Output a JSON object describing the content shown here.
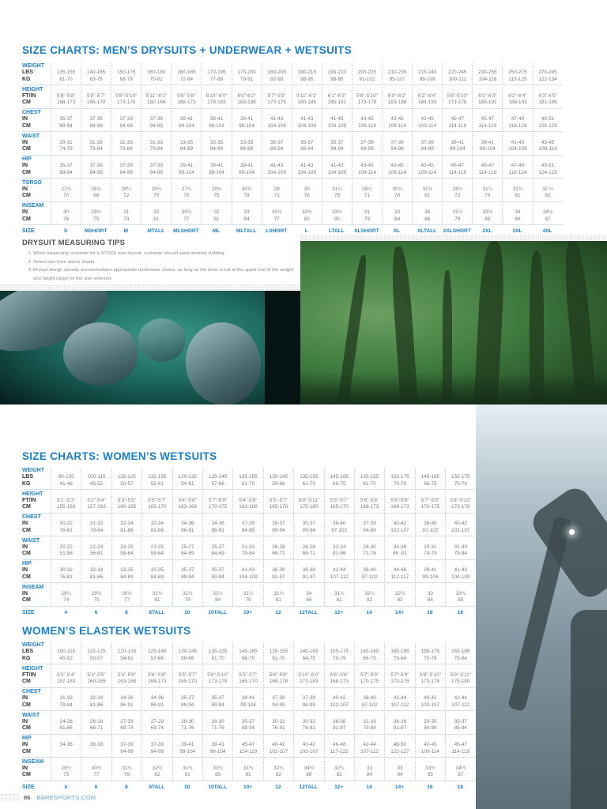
{
  "men": {
    "title": "SIZE CHARTS: MEN’S DRYSUITS + UNDERWEAR + WETSUITS",
    "groups": [
      {
        "group": "WEIGHT",
        "units": [
          "LBS",
          "KG"
        ],
        "rows": [
          [
            "135-155",
            "140-165",
            "150-175",
            "160-180",
            "160-185",
            "170-195",
            "175-200",
            "180-205",
            "190-215",
            "195-210",
            "200-225",
            "210-235",
            "215-240",
            "220-245",
            "230-255",
            "250-275",
            "270-295"
          ],
          [
            "61-70",
            "63-75",
            "68-79",
            "70-82",
            "72-84",
            "77-88",
            "79-91",
            "82-93",
            "88-95",
            "88-95",
            "91-102",
            "95-107",
            "98-109",
            "100-111",
            "104-116",
            "113-125",
            "122-134"
          ]
        ]
      },
      {
        "group": "HEIGHT",
        "units": [
          "FT/IN",
          "CM"
        ],
        "rows": [
          [
            "5'6\"-5'8\"",
            "5'5\"-5'7\"",
            "5'8\"-5'10\"",
            "5'11\"-6'1\"",
            "5'6\"-5'8\"",
            "5'10\"-6'0\"",
            "6'0\"-6'2\"",
            "5'7\"-5'9\"",
            "5'11\"-6'1\"",
            "6'1\"-6'3\"",
            "5'8\"-5'10\"",
            "6'0\"-6'2\"",
            "6'2\"-6'4\"",
            "5'8\"-5'10\"",
            "6'1\"-6'3\"",
            "6'2\"-6'4\"",
            "6'3\"-6'5\""
          ],
          [
            "168-173",
            "165-170",
            "173-178",
            "180-184",
            "168-173",
            "178-183",
            "183-188",
            "170-175",
            "180-185",
            "185-191",
            "173-178",
            "183-188",
            "188-193",
            "173-178",
            "185-191",
            "188-193",
            "191-196"
          ]
        ]
      },
      {
        "group": "CHEST",
        "units": [
          "IN",
          "CM"
        ],
        "rows": [
          [
            "35-37",
            "37-39",
            "37-39",
            "37-39",
            "39-41",
            "39-41",
            "39-41",
            "41-43",
            "41-43",
            "41-43",
            "43-45",
            "43-45",
            "43-45",
            "45-47",
            "45-47",
            "47-49",
            "49-51"
          ],
          [
            "89-94",
            "94-99",
            "94-99",
            "94-99",
            "99-104",
            "99-104",
            "99-104",
            "104-109",
            "104-109",
            "104-109",
            "109-114",
            "109-114",
            "109-114",
            "114-119",
            "114-119",
            "119-124",
            "124-129"
          ]
        ]
      },
      {
        "group": "WAIST",
        "units": [
          "IN",
          "CM"
        ],
        "rows": [
          [
            "29-31",
            "31-33",
            "31-33",
            "31-33",
            "33-35",
            "33-35",
            "33-35",
            "35-37",
            "35-37",
            "35-37",
            "37-39",
            "37-39",
            "37-39",
            "39-41",
            "39-41",
            "41-43",
            "43-45"
          ],
          [
            "74-79",
            "79-84",
            "79-84",
            "79-84",
            "84-89",
            "84-89",
            "84-89",
            "89-94",
            "89-94",
            "89-94",
            "94-99",
            "94-99",
            "94-99",
            "99-104",
            "99-104",
            "104-109",
            "109-114"
          ]
        ]
      },
      {
        "group": "HIP",
        "units": [
          "IN",
          "CM"
        ],
        "rows": [
          [
            "35-37",
            "37-39",
            "37-39",
            "37-39",
            "39-41",
            "39-41",
            "39-41",
            "41-43",
            "41-43",
            "41-43",
            "43-45",
            "43-45",
            "43-45",
            "45-47",
            "45-47",
            "47-49",
            "49-51"
          ],
          [
            "89-94",
            "94-99",
            "94-99",
            "94-99",
            "99-104",
            "99-104",
            "99-104",
            "104-109",
            "104-109",
            "104-109",
            "109-114",
            "109-114",
            "109-114",
            "114-119",
            "114-119",
            "119-124",
            "124-129"
          ]
        ]
      },
      {
        "group": "TORSO",
        "units": [
          "IN",
          "CM"
        ],
        "rows": [
          [
            "27¾",
            "26¾",
            "28¼",
            "29¾",
            "27¾",
            "29¾",
            "30¾",
            "28",
            "30",
            "31¼",
            "28¼",
            "30¾",
            "31¾",
            "28½",
            "31¼",
            "31¾",
            "32 ¼"
          ],
          [
            "70",
            "68",
            "72",
            "75",
            "70",
            "75",
            "78",
            "71",
            "76",
            "79",
            "71",
            "78",
            "81",
            "72",
            "79",
            "81",
            "82"
          ]
        ]
      },
      {
        "group": "INSEAM",
        "units": [
          "IN",
          "CM"
        ],
        "rows": [
          [
            "30",
            "29½",
            "31",
            "32",
            "30½",
            "32",
            "33",
            "30½",
            "32½",
            "33½",
            "31",
            "33",
            "34",
            "31½",
            "33½",
            "34",
            "34½"
          ],
          [
            "76",
            "75",
            "79",
            "81",
            "77",
            "81",
            "84",
            "77",
            "83",
            "85",
            "79",
            "84",
            "86",
            "79",
            "85",
            "86",
            "87"
          ]
        ]
      }
    ],
    "size_label": "SIZE",
    "sizes": [
      "S",
      "MSHORT",
      "M",
      "MTALL",
      "MLSHORT",
      "ML",
      "MLTALL",
      "LSHORT",
      "L",
      "LTALL",
      "XLSHORT",
      "XL",
      "XLTALL",
      "2XLSHORT",
      "2XL",
      "3XL",
      "4XL"
    ]
  },
  "tips": {
    "title": "DRYSUIT MEASURING TIPS",
    "items": [
      "When measuring customer for a STOCK size drysuit, customer should wear minimal clothing.",
      "Select size from above charts.",
      "Drysuit design already accommodates appropriate underwear choice, as long as the diver is not at the upper end of the weight and height range for the size selected."
    ]
  },
  "women": {
    "title": "SIZE CHARTS: WOMEN’S WETSUITS",
    "groups": [
      {
        "group": "WEIGHT",
        "units": [
          "LBS",
          "KG"
        ],
        "rows": [
          [
            "90-105",
            "100-115",
            "115-125",
            "115-135",
            "120-135",
            "125-145",
            "135-155",
            "130-145",
            "135-155",
            "145-165",
            "135-155",
            "155-175",
            "145-165",
            "155-175"
          ],
          [
            "41-48",
            "45-52",
            "50-57",
            "52-61",
            "54-61",
            "57-66",
            "61-70",
            "59-66",
            "61-70",
            "66-75",
            "61-70",
            "70-79",
            "66-75",
            "70-79"
          ]
        ]
      },
      {
        "group": "HEIGHT",
        "units": [
          "FT/IN",
          "CM"
        ],
        "rows": [
          [
            "5'1\"-5'3\"",
            "5'2\"-5'4\"",
            "5'3\"-5'5\"",
            "5'5\"-5'7\"",
            "5'4\"-5'6\"",
            "5'7\"-5'9\"",
            "5'4\"-5'6\"",
            "5'5\"-5'7\"",
            "5'9\"-5'11\"",
            "5'5\"-5'7\"",
            "5'6\"-5'8\"",
            "5'6\"-5'8\"",
            "5'7\"-5'9\"",
            "5'8\"-5'10\""
          ],
          [
            "155-160",
            "157-163",
            "160-165",
            "165-170",
            "163-168",
            "170-175",
            "163-168",
            "165-170",
            "175-180",
            "165-170",
            "168-173",
            "168-173",
            "170-175",
            "173-178"
          ]
        ]
      },
      {
        "group": "CHEST",
        "units": [
          "IN",
          "CM"
        ],
        "rows": [
          [
            "30-32",
            "31-33",
            "32-34",
            "32-34",
            "34-36",
            "34-36",
            "37-39",
            "35-37",
            "35-37",
            "38-40",
            "37-39",
            "40-42",
            "38-40",
            "40-42"
          ],
          [
            "76-81",
            "79-84",
            "81-86",
            "81-86",
            "86-91",
            "86-91",
            "94-99",
            "89-94",
            "89-94",
            "97-102",
            "94-99",
            "102-107",
            "97-102",
            "102-107"
          ]
        ]
      },
      {
        "group": "WAIST",
        "units": [
          "IN",
          "CM"
        ],
        "rows": [
          [
            "20-22",
            "22-24",
            "23-25",
            "23-25",
            "25-27",
            "25-27",
            "31-33",
            "26-28",
            "26-28",
            "32-34",
            "28-30",
            "34-36",
            "29-31",
            "31-33"
          ],
          [
            "51-56",
            "56-61",
            "58-64",
            "58-64",
            "64-69",
            "64-69",
            "79-84",
            "66-71",
            "66-71",
            "81-86",
            "71-76",
            "86 -91",
            "74-79",
            "79-84"
          ]
        ]
      },
      {
        "group": "HIP",
        "units": [
          "IN",
          "CM"
        ],
        "rows": [
          [
            "30-32",
            "32-34",
            "33-35",
            "33-35",
            "35-37",
            "35-37",
            "41-43",
            "36-38",
            "36-38",
            "42-44",
            "38-40",
            "44-46",
            "39-41",
            "41-43"
          ],
          [
            "76-81",
            "81-86",
            "84-89",
            "84-89",
            "89-94",
            "89-94",
            "104-109",
            "91-97",
            "91-97",
            "107-112",
            "97-102",
            "112-117",
            "99-104",
            "104-109"
          ]
        ]
      },
      {
        "group": "INSEAM",
        "units": [
          "IN",
          "CM"
        ],
        "rows": [
          [
            "29¼",
            "29½",
            "30½",
            "31¾",
            "31¼",
            "32½",
            "31¼",
            "31¾",
            "34",
            "31¾",
            "32¼",
            "32¼",
            "33",
            "33¾"
          ],
          [
            "74",
            "75",
            "77",
            "81",
            "79",
            "84",
            "79",
            "81",
            "86",
            "81",
            "82",
            "82",
            "84",
            "85"
          ]
        ]
      }
    ],
    "size_label": "SIZE",
    "sizes": [
      "4",
      "6",
      "8",
      "8TALL",
      "10",
      "10TALL",
      "10+",
      "12",
      "12TALL",
      "12+",
      "14",
      "14+",
      "16",
      "18"
    ]
  },
  "elastek": {
    "title": "WOMEN’S ELASTEK WETSUITS",
    "groups": [
      {
        "group": "WEIGHT",
        "units": [
          "LBS",
          "KG"
        ],
        "rows": [
          [
            "100-115",
            "115-125",
            "120-135",
            "125-145",
            "130-145",
            "135-155",
            "145-165",
            "135-155",
            "140-165",
            "155-175",
            "145-165",
            "165-185",
            "155-175",
            "165-185"
          ],
          [
            "45-52",
            "50-57",
            "54-61",
            "57-66",
            "59-66",
            "61-70",
            "66-75",
            "61-70",
            "64-75",
            "70-79",
            "66-75",
            "75-84",
            "70-79",
            "75-84"
          ]
        ]
      },
      {
        "group": "HEIGHT",
        "units": [
          "FT/IN",
          "CM"
        ],
        "rows": [
          [
            "5'2\"-5'4\"",
            "5'3\"-5'5\"",
            "5'4\"-5'6\"",
            "5'6\"-5'8\"",
            "5'5\"-5'7\"",
            "5'8\"-5'10\"",
            "5'5\"-5'7\"",
            "5'6\"-5'8\"",
            "5'10\"-6'0\"",
            "5'6\"-5'8\"",
            "5'7\"-5'9\"",
            "5'7\"-5'9\"",
            "5'8\"-5'10\"",
            "5'9\"-5'11\""
          ],
          [
            "157-163",
            "160-165",
            "163-168",
            "168-173",
            "165-170",
            "173-178",
            "165-170",
            "168-178",
            "173-183",
            "168-173",
            "170-175",
            "170-175",
            "173-178",
            "175-180"
          ]
        ]
      },
      {
        "group": "CHEST",
        "units": [
          "IN",
          "CM"
        ],
        "rows": [
          [
            "31-33",
            "32-34",
            "34-36",
            "34-36",
            "35-37",
            "35-37",
            "39-41",
            "37-39",
            "37-39",
            "40-42",
            "38-40",
            "42-44",
            "40-42",
            "42-44"
          ],
          [
            "79-84",
            "81-86",
            "86-91",
            "86-91",
            "89-94",
            "89-94",
            "99-104",
            "94-99",
            "94-99",
            "102-107",
            "97-102",
            "107-112",
            "102-107",
            "107-112"
          ]
        ]
      },
      {
        "group": "WAIST",
        "units": [
          "IN",
          "CM"
        ],
        "rows": [
          [
            "24-26",
            "26-28",
            "27-29",
            "27-29",
            "28-30",
            "28-30",
            "35-37",
            "30-32",
            "30-32",
            "36-38",
            "31-33",
            "36-38",
            "33-35",
            "35-37"
          ],
          [
            "61-66",
            "66-71",
            "69-74",
            "69-74",
            "71-76",
            "71-76",
            "89-94",
            "76-81",
            "76-81",
            "91-97",
            "79-84",
            "91-97",
            "84-89",
            "89-94"
          ]
        ]
      },
      {
        "group": "HIP",
        "units": [
          "IN",
          "CM"
        ],
        "rows": [
          [
            "34-36",
            "36-38",
            "37-39",
            "37-39",
            "39-41",
            "39-41",
            "45-47",
            "40-42",
            "40-42",
            "46-48",
            "42-44",
            "48-50",
            "43-45",
            "45-47"
          ],
          [
            "",
            "",
            "94-99",
            "94-99",
            "99-104",
            "99-104",
            "114-119",
            "102-107",
            "102-107",
            "117-122",
            "107-112",
            "122-127",
            "109-114",
            "114-119"
          ]
        ]
      },
      {
        "group": "INSEAM",
        "units": [
          "IN",
          "CM"
        ],
        "rows": [
          [
            "29½",
            "30½",
            "31¼",
            "32¼",
            "31¾",
            "33½",
            "31¾",
            "32¼",
            "34¾",
            "32¼",
            "33",
            "33",
            "33½",
            "34½"
          ],
          [
            "75",
            "77",
            "79",
            "82",
            "81",
            "85",
            "81",
            "82",
            "88",
            "82",
            "84",
            "84",
            "85",
            "87"
          ]
        ]
      }
    ],
    "size_label": "SIZE",
    "sizes": [
      "4",
      "6",
      "8",
      "8TALL",
      "10",
      "10TALL",
      "10+",
      "12",
      "12TALL",
      "12+",
      "14",
      "14+",
      "16",
      "18"
    ]
  },
  "footer": {
    "page_number": "86",
    "site": "BARESPORTS.COM"
  }
}
